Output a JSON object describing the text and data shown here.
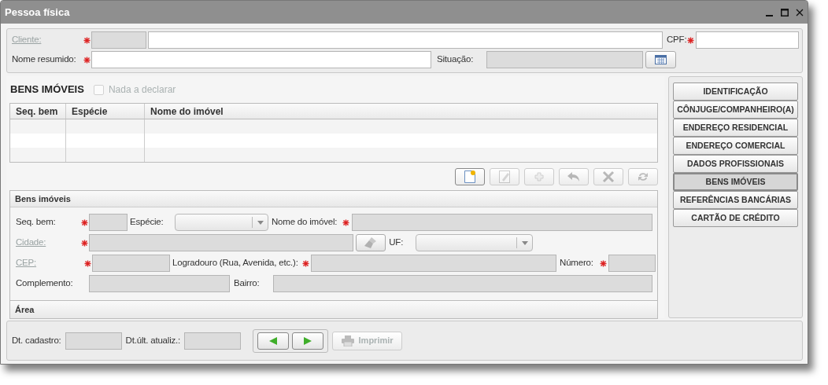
{
  "window": {
    "title": "Pessoa física"
  },
  "client_panel": {
    "rows": [
      {
        "items": [
          {
            "kind": "label",
            "text": "Cliente:",
            "link": true
          },
          {
            "kind": "required"
          },
          {
            "kind": "field",
            "disabled": true
          },
          {
            "kind": "field",
            "disabled": false
          },
          {
            "kind": "label",
            "text": "CPF:",
            "link": false
          },
          {
            "kind": "required"
          },
          {
            "kind": "field",
            "disabled": false
          }
        ]
      },
      {
        "items": [
          {
            "kind": "label",
            "text": "Nome resumido:",
            "link": false
          },
          {
            "kind": "required"
          },
          {
            "kind": "field",
            "disabled": false
          },
          {
            "kind": "label",
            "text": "Situação:",
            "link": false
          },
          {
            "kind": "field",
            "disabled": true
          },
          {
            "kind": "calendar_button"
          }
        ]
      }
    ]
  },
  "assets": {
    "title": "BENS IMÓVEIS",
    "nothing_to_declare": {
      "label": "Nada a declarar",
      "checked": false,
      "disabled": true
    },
    "table": {
      "columns": [
        "Seq. bem",
        "Espécie",
        "Nome do imóvel"
      ]
    },
    "toolbar": [
      {
        "kind": "new",
        "disabled": false
      },
      {
        "kind": "edit",
        "disabled": true
      },
      {
        "kind": "add",
        "disabled": true
      },
      {
        "kind": "undo",
        "disabled": true
      },
      {
        "kind": "delete",
        "disabled": true
      },
      {
        "kind": "refresh",
        "disabled": true
      }
    ],
    "sections": [
      {
        "title": "Bens imóveis",
        "expanded": true,
        "rows": [
          {
            "items": [
              {
                "kind": "label",
                "text": "Seq. bem:",
                "link": false
              },
              {
                "kind": "required"
              },
              {
                "kind": "field",
                "disabled": true
              },
              {
                "kind": "label",
                "text": "Espécie:",
                "link": false
              },
              {
                "kind": "select",
                "disabled": false
              },
              {
                "kind": "label",
                "text": "Nome do imóvel:",
                "link": false
              },
              {
                "kind": "required"
              },
              {
                "kind": "field",
                "disabled": true
              }
            ]
          },
          {
            "items": [
              {
                "kind": "label",
                "text": "Cidade:",
                "link": true
              },
              {
                "kind": "required"
              },
              {
                "kind": "field",
                "disabled": true
              },
              {
                "kind": "clear_button"
              },
              {
                "kind": "label",
                "text": "UF:",
                "link": false
              },
              {
                "kind": "select",
                "disabled": false
              }
            ]
          },
          {
            "items": [
              {
                "kind": "label",
                "text": "CEP:",
                "link": true
              },
              {
                "kind": "required"
              },
              {
                "kind": "field",
                "disabled": true
              },
              {
                "kind": "label",
                "text": "Logradouro (Rua, Avenida, etc.):",
                "link": false
              },
              {
                "kind": "required"
              },
              {
                "kind": "field",
                "disabled": true
              },
              {
                "kind": "label",
                "text": "Número:",
                "link": false
              },
              {
                "kind": "required"
              },
              {
                "kind": "field",
                "disabled": true
              }
            ]
          },
          {
            "items": [
              {
                "kind": "label",
                "text": "Complemento:",
                "link": false
              },
              {
                "kind": "field",
                "disabled": true
              },
              {
                "kind": "label",
                "text": "Bairro:",
                "link": false
              },
              {
                "kind": "field",
                "disabled": true
              }
            ]
          }
        ]
      },
      {
        "title": "Área",
        "expanded": false
      }
    ]
  },
  "side_nav": [
    {
      "label": "IDENTIFICAÇÃO",
      "selected": false
    },
    {
      "label": "CÔNJUGE/COMPANHEIRO(A)",
      "selected": false
    },
    {
      "label": "ENDEREÇO RESIDENCIAL",
      "selected": false
    },
    {
      "label": "ENDEREÇO COMERCIAL",
      "selected": false
    },
    {
      "label": "DADOS PROFISSIONAIS",
      "selected": false
    },
    {
      "label": "BENS IMÓVEIS",
      "selected": true
    },
    {
      "label": "REFERÊNCIAS BANCÁRIAS",
      "selected": false
    },
    {
      "label": "CARTÃO DE CRÉDITO",
      "selected": false
    }
  ],
  "footer": {
    "fields": [
      {
        "label": "Dt. cadastro:",
        "disabled": true
      },
      {
        "label": "Dt.últ. atualiz.:",
        "disabled": true
      }
    ],
    "nav_buttons": [
      {
        "kind": "previous"
      },
      {
        "kind": "next"
      }
    ],
    "print_button": {
      "label": "Imprimir",
      "disabled": true
    }
  }
}
